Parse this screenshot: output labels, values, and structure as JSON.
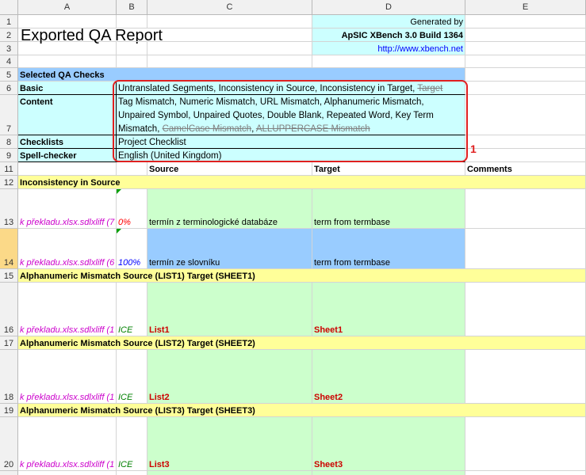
{
  "columns": [
    "A",
    "B",
    "C",
    "D",
    "E"
  ],
  "header": {
    "title": "Exported QA Report",
    "generated_by": "Generated by",
    "product": "ApSIC XBench 3.0 Build 1364",
    "url": "http://www.xbench.net"
  },
  "qa_checks": {
    "heading": "Selected QA Checks",
    "basic_label": "Basic",
    "basic_value": "Untranslated Segments, Inconsistency in Source, Inconsistency in Target,",
    "basic_struck": "Target",
    "content_label": "Content",
    "content_line1": "Tag Mismatch, Numeric Mismatch, URL Mismatch, Alphanumeric Mismatch,",
    "content_line2": "Unpaired Symbol, Unpaired Quotes, Double Blank, Repeated Word, Key Term",
    "content_line3": "Mismatch,",
    "content_struck1": "CamelCase Mismatch",
    "content_struck2": "ALLUPPERCASE Mismatch",
    "checklists_label": "Checklists",
    "checklists_value": "Project Checklist",
    "spell_label": "Spell-checker",
    "spell_value": "English (United Kingdom)"
  },
  "table_header": {
    "source": "Source",
    "target": "Target",
    "comments": "Comments"
  },
  "annotation": "1",
  "sections": [
    {
      "row": "12",
      "title": "Inconsistency in Source"
    },
    {
      "row": "15",
      "title": "Alphanumeric Mismatch Source (LIST1) Target (SHEET1)"
    },
    {
      "row": "17",
      "title": "Alphanumeric Mismatch Source (LIST2) Target (SHEET2)"
    },
    {
      "row": "19",
      "title": "Alphanumeric Mismatch Source (LIST3) Target (SHEET3)"
    }
  ],
  "entries": [
    {
      "row": "13",
      "file": "k překladu.xlsx.sdlxliff (7",
      "match": "0%",
      "source": "termín z terminologické databáze",
      "target": "term from termbase"
    },
    {
      "row": "14",
      "file": "k překladu.xlsx.sdlxliff (6",
      "match": "100%",
      "source": "termín ze slovníku",
      "target": "term from termbase"
    },
    {
      "row": "16",
      "file": "k překladu.xlsx.sdlxliff (1",
      "match": "ICE",
      "source": "List1",
      "target": "Sheet1"
    },
    {
      "row": "18",
      "file": "k překladu.xlsx.sdlxliff (1",
      "match": "ICE",
      "source": "List2",
      "target": "Sheet2"
    },
    {
      "row": "20",
      "file": "k překladu.xlsx.sdlxliff (1",
      "match": "ICE",
      "source": "List3",
      "target": "Sheet3"
    }
  ],
  "row_numbers": [
    "1",
    "2",
    "3",
    "4",
    "5",
    "6",
    "7",
    "8",
    "9",
    "11",
    "12",
    "13",
    "14",
    "15",
    "16",
    "17",
    "18",
    "19",
    "20"
  ]
}
